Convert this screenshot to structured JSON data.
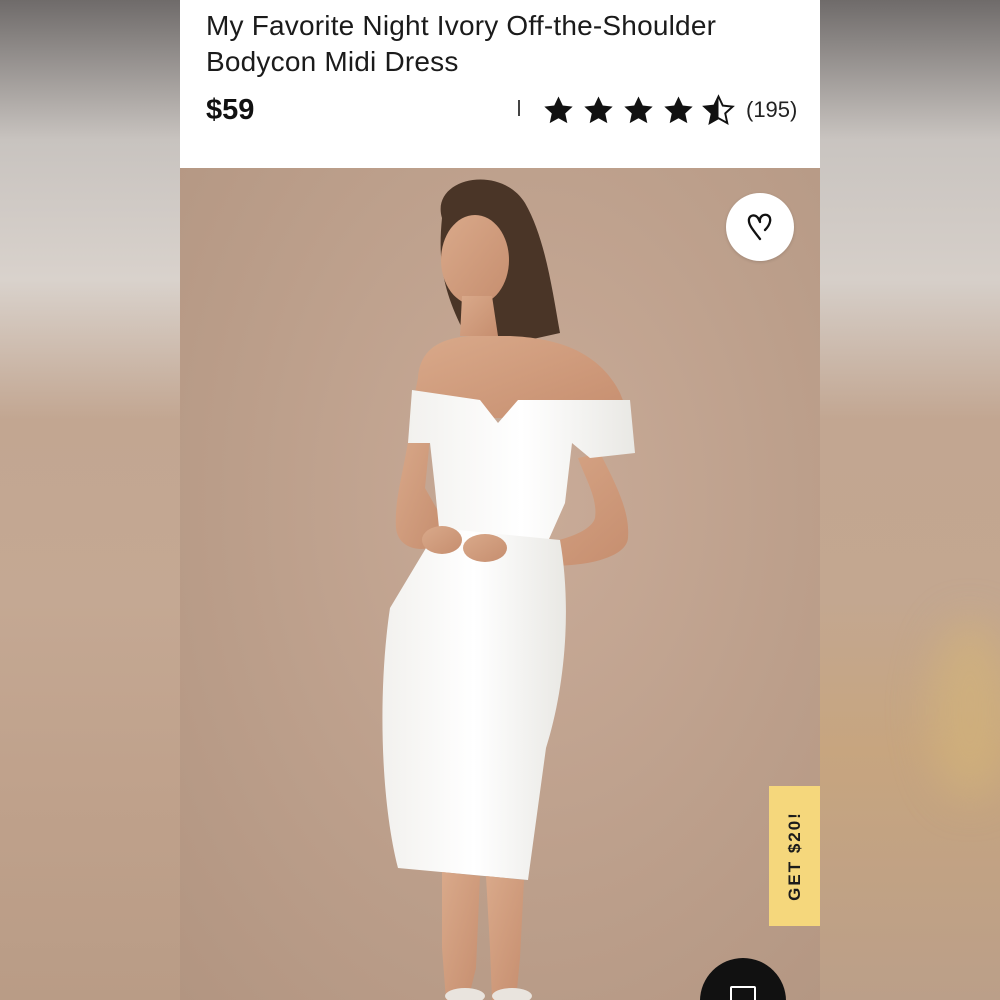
{
  "product": {
    "title": "My Favorite Night Ivory Off-the-Shoulder Bodycon Midi Dress",
    "price": "$59",
    "rating": 4.5,
    "rating_max": 5,
    "review_count": "(195)"
  },
  "image": {
    "description": "model-in-ivory-off-shoulder-midi-dress",
    "favorite_icon": "heart-icon"
  },
  "promo": {
    "label": "GET $20!"
  },
  "chat": {
    "icon": "chat-icon"
  },
  "colors": {
    "backdrop": "#bc9f8b",
    "promo": "#f5d77c",
    "text": "#1b1b1b"
  }
}
